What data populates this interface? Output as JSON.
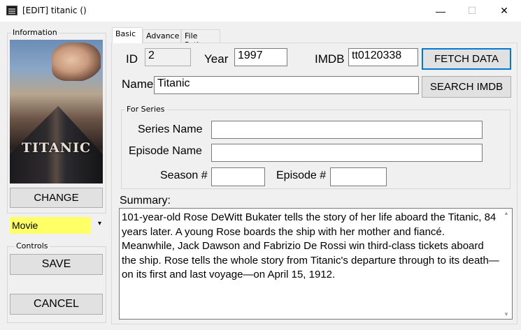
{
  "window": {
    "title": "[EDIT] titanic ()",
    "minimize": "—",
    "maximize": "☐",
    "close": "✕"
  },
  "left_panel": {
    "information_label": "Information",
    "poster_title": "TITANIC",
    "change_button": "CHANGE",
    "type_select": {
      "value": "Movie",
      "arrow": "▾"
    },
    "controls_label": "Controls",
    "save_button": "SAVE",
    "cancel_button": "CANCEL"
  },
  "tabs": [
    {
      "label": "Basic",
      "active": true
    },
    {
      "label": "Advance",
      "active": false
    },
    {
      "label": "File Paths",
      "active": false
    }
  ],
  "basic": {
    "id_label": "ID",
    "id_value": "2",
    "year_label": "Year",
    "year_value": "1997",
    "imdb_label": "IMDB",
    "imdb_value": "tt0120338",
    "fetch_button": "FETCH DATA",
    "name_label": "Name",
    "name_value": "Titanic",
    "search_button": "SEARCH IMDB",
    "for_series_label": "For Series",
    "series_name_label": "Series Name",
    "series_name_value": "",
    "episode_name_label": "Episode Name",
    "episode_name_value": "",
    "season_label": "Season #",
    "season_value": "",
    "episode_label": "Episode #",
    "episode_value": "",
    "summary_label": "Summary:",
    "summary_text": "101-year-old Rose DeWitt Bukater tells the story of her life aboard the Titanic, 84 years later. A young Rose boards the ship with her mother and fiancé. Meanwhile, Jack Dawson and Fabrizio De Rossi win third-class tickets aboard the ship. Rose tells the whole story from Titanic's departure through to its death—on its first and last voyage—on April 15, 1912."
  },
  "colors": {
    "type_select_bg": "#ffff66",
    "focus_border": "#0078d7"
  }
}
